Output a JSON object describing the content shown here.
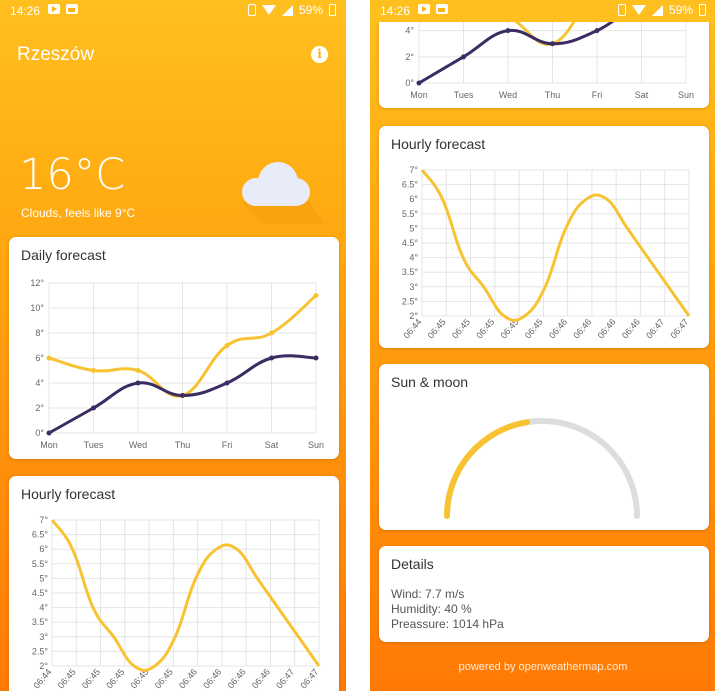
{
  "statusbar": {
    "time": "14:26",
    "battery": "59%"
  },
  "location": {
    "city": "Rzeszów"
  },
  "current": {
    "temperature": "16°C",
    "description": "Clouds, feels like 9°C",
    "icon": "cloud-icon"
  },
  "daily": {
    "title": "Daily forecast",
    "chart_data": {
      "type": "line",
      "categories": [
        "Mon",
        "Tues",
        "Wed",
        "Thu",
        "Fri",
        "Sat",
        "Sun"
      ],
      "y_tick_labels": [
        "0°",
        "2°",
        "4°",
        "6°",
        "8°",
        "10°",
        "12°"
      ],
      "ylim": [
        0,
        12
      ],
      "series": [
        {
          "name": "",
          "color": "#f7c332",
          "values": [
            6,
            5,
            5,
            3,
            7,
            8,
            11
          ]
        },
        {
          "name": "",
          "color": "#3b2c63",
          "values": [
            0,
            2,
            4,
            3,
            4,
            6,
            6
          ]
        }
      ]
    }
  },
  "hourly": {
    "title": "Hourly forecast",
    "chart_data": {
      "type": "line",
      "categories": [
        "06:44",
        "06:45",
        "06:45",
        "06:45",
        "06:45",
        "06:45",
        "06:46",
        "06:46",
        "06:46",
        "06:46",
        "06:47",
        "06:47"
      ],
      "y_tick_labels": [
        "2°",
        "2.5°",
        "3°",
        "3.5°",
        "4°",
        "4.5°",
        "5°",
        "5.5°",
        "6°",
        "6.5°",
        "7°"
      ],
      "ylim": [
        2,
        7
      ],
      "series": [
        {
          "name": "",
          "color": "#f7c332",
          "values": [
            7,
            6,
            4,
            3,
            2,
            2,
            3,
            5,
            6,
            6,
            5,
            4,
            3,
            2
          ]
        }
      ]
    }
  },
  "sun_moon": {
    "title": "Sun & moon",
    "progress": 0.45,
    "arc_color": "#f7c332",
    "track_color": "#dddddd"
  },
  "details": {
    "title": "Details",
    "wind": "Wind: 7.7 m/s",
    "humidity": "Humidity: 40 %",
    "pressure": "Preassure: 1014 hPa"
  },
  "footer": {
    "powered_by": "powered by openweathermap.com"
  }
}
